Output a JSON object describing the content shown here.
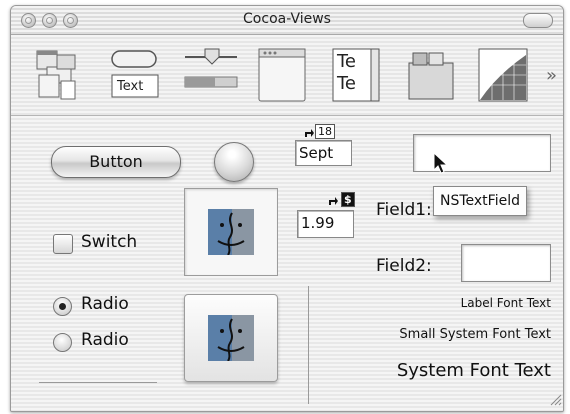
{
  "window": {
    "title": "Cocoa-Views"
  },
  "toolbar": {
    "items": [
      {
        "name": "window-views-icon"
      },
      {
        "name": "button-text-views-icon",
        "text_label": "Text"
      },
      {
        "name": "slider-views-icon"
      },
      {
        "name": "window-container-icon"
      },
      {
        "name": "text-view-icon",
        "lines": [
          "Te",
          "Te"
        ]
      },
      {
        "name": "tab-view-icon"
      },
      {
        "name": "graphics-view-icon"
      }
    ],
    "more": "»"
  },
  "controls": {
    "button_label": "Button",
    "date_field": {
      "value": "Sept",
      "tag": "18"
    },
    "number_field": {
      "value": "1.99",
      "tag": "$"
    },
    "switch_label": "Switch",
    "radio1_label": "Radio",
    "radio2_label": "Radio",
    "field1_label": "Field1:",
    "field2_label": "Field2:",
    "tooltip": "NSTextField"
  },
  "text_samples": {
    "label_font": "Label Font Text",
    "small_system_font": "Small System Font Text",
    "system_font": "System Font Text"
  },
  "colors": {
    "finder_blue": "#5a7fa8",
    "finder_face": "#8a96a3"
  }
}
